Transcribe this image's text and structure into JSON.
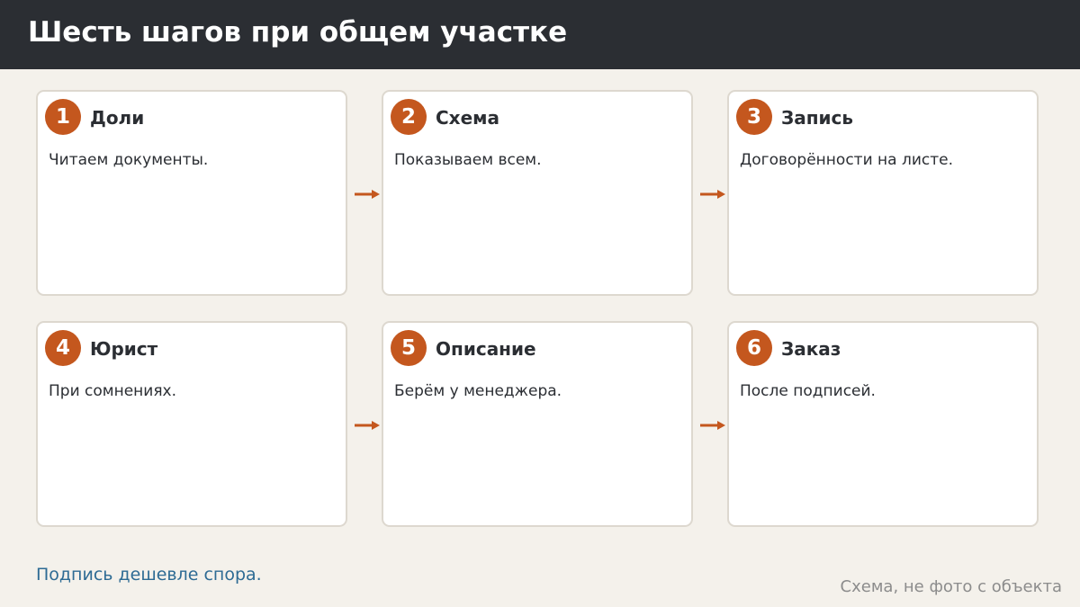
{
  "header": {
    "title": "Шесть шагов при общем участке"
  },
  "steps": [
    {
      "number": "1",
      "title": "Доли",
      "text": "Читаем документы."
    },
    {
      "number": "2",
      "title": "Схема",
      "text": "Показываем всем."
    },
    {
      "number": "3",
      "title": "Запись",
      "text": "Договорённости на листе."
    },
    {
      "number": "4",
      "title": "Юрист",
      "text": "При сомнениях."
    },
    {
      "number": "5",
      "title": "Описание",
      "text": "Берём у менеджера."
    },
    {
      "number": "6",
      "title": "Заказ",
      "text": "После подписей."
    }
  ],
  "footer": {
    "note": "Подпись дешевле спора.",
    "caption": "Схема, не фото с объекта"
  },
  "colors": {
    "accent": "#c4571e",
    "header_bg": "#2b2e33",
    "page_bg": "#f4f1eb",
    "note": "#2e6b94"
  }
}
